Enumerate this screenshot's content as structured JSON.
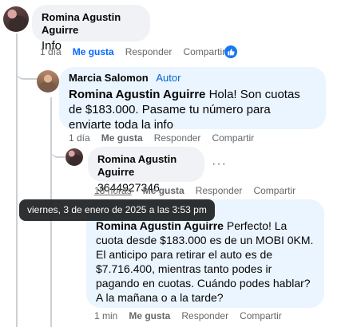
{
  "comment1": {
    "author": "Romina Agustin Aguirre",
    "text": "Info",
    "time": "1 día",
    "like_label": "Me gusta",
    "reply_label": "Responder",
    "share_label": "Compartir",
    "reaction_icon": "like-reaction-icon"
  },
  "comment2": {
    "author": "Marcia Salomon",
    "author_badge": "Autor",
    "mention": "Romina Agustin Aguirre",
    "text": " Hola! Son cuotas de $183.000. Pasame tu número para enviarte toda la info",
    "time": "1 día",
    "like_label": "Me gusta",
    "reply_label": "Responder",
    "share_label": "Compartir"
  },
  "comment3": {
    "author": "Romina Agustin Aguirre",
    "text": "3644927346",
    "more_label": "···",
    "time": "18 horas",
    "like_label": "Me gusta",
    "reply_label": "Responder",
    "share_label": "Compartir"
  },
  "comment4": {
    "mention": "Romina Agustin Aguirre",
    "text": " Perfecto! La cuota desde $183.000 es de un MOBI 0KM. El anticipo para retirar el auto es de $7.716.400, mientras tanto podes ir pagando en cuotas. Cuándo podes hablar? A la mañana o a la tarde?",
    "time": "1 min",
    "like_label": "Me gusta",
    "reply_label": "Responder",
    "share_label": "Compartir"
  },
  "tooltip": {
    "text": "viernes, 3 de enero de 2025 a las 3:53 pm"
  },
  "colors": {
    "bubble_gray": "#f0f2f5",
    "bubble_blue": "#ebf5ff",
    "like_blue": "#0866ff",
    "meta_gray": "#65676b"
  }
}
